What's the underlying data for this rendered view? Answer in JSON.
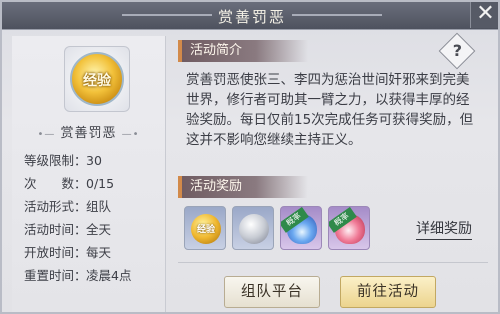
{
  "window": {
    "title": "赏善罚恶",
    "close_label": "✕"
  },
  "activity": {
    "icon_text": "经验",
    "name": "赏善罚恶",
    "info": [
      {
        "label": "等级限制：",
        "value": "30"
      },
      {
        "label": "次　　数：",
        "value": "0/15"
      },
      {
        "label": "活动形式：",
        "value": "组队"
      },
      {
        "label": "活动时间：",
        "value": "全天"
      },
      {
        "label": "开放时间：",
        "value": "每天"
      },
      {
        "label": "重置时间：",
        "value": "凌晨4点"
      }
    ]
  },
  "intro": {
    "header": "活动简介",
    "help_label": "?",
    "text": "赏善罚恶使张三、李四为惩治世间奸邪来到完美世界，修行者可助其一臂之力，以获得丰厚的经验奖励。每日仅前15次完成任务可获得奖励，但这并不影响您继续主持正义。"
  },
  "rewards": {
    "header": "活动奖励",
    "items": [
      {
        "icon": "exp-orb-icon",
        "text": "经验",
        "tag": ""
      },
      {
        "icon": "silver-coin-icon",
        "text": "",
        "tag": ""
      },
      {
        "icon": "blue-flame-icon",
        "text": "",
        "tag": "概率"
      },
      {
        "icon": "pink-flame-icon",
        "text": "",
        "tag": "概率"
      }
    ],
    "detail_link": "详细奖励"
  },
  "buttons": {
    "team_platform": "组队平台",
    "go_activity": "前往活动"
  },
  "colors": {
    "title_bar": "#565a66",
    "section_header": "#6e5a60",
    "accent_gold": "#ecd48e"
  }
}
